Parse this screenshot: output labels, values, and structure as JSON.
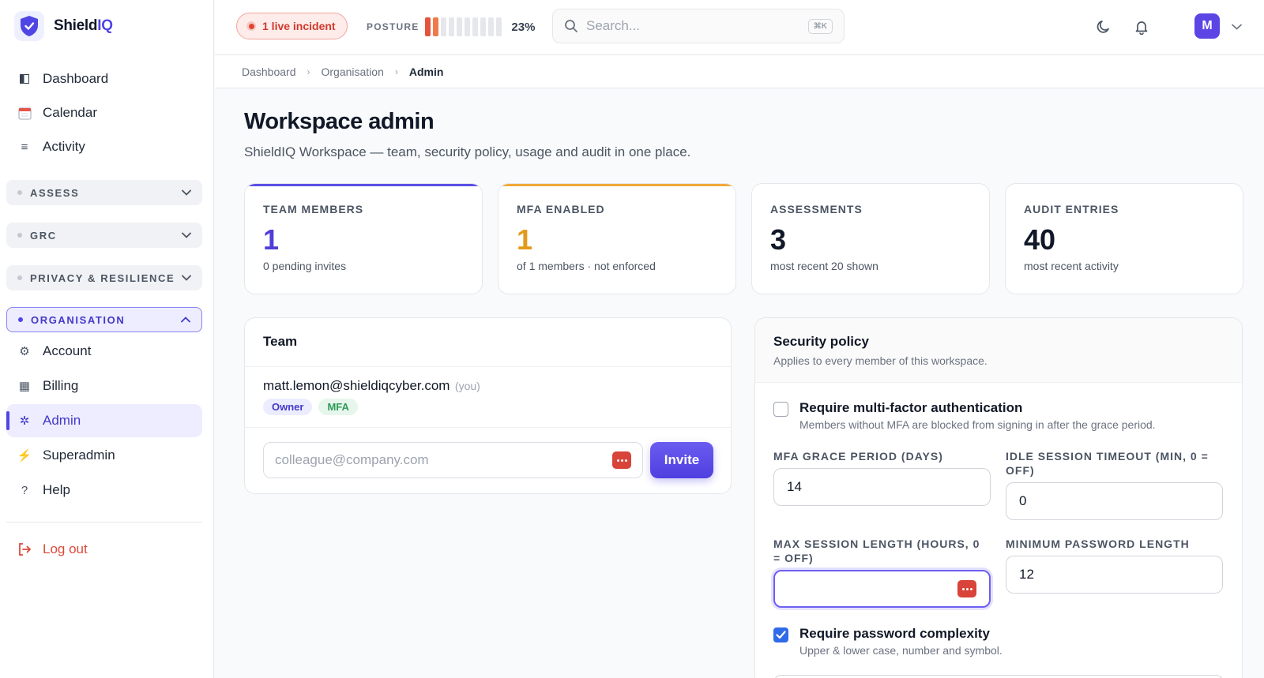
{
  "brand": {
    "name_main": "Shield",
    "name_accent": "IQ"
  },
  "sidebar": {
    "top_items": [
      {
        "label": "Dashboard",
        "icon": "sidebar-panel-icon"
      },
      {
        "label": "Calendar",
        "icon": "calendar-icon"
      },
      {
        "label": "Activity",
        "icon": "list-icon"
      }
    ],
    "groups": [
      {
        "label": "ASSESS",
        "expanded": false
      },
      {
        "label": "GRC",
        "expanded": false
      },
      {
        "label": "PRIVACY & RESILIENCE",
        "expanded": false
      },
      {
        "label": "ORGANISATION",
        "expanded": true
      }
    ],
    "org_items": [
      {
        "label": "Account",
        "icon": "gear-icon"
      },
      {
        "label": "Billing",
        "icon": "grid-icon"
      },
      {
        "label": "Admin",
        "icon": "cog-icon",
        "active": true
      },
      {
        "label": "Superadmin",
        "icon": "lightning-icon"
      },
      {
        "label": "Help",
        "icon": "question-icon"
      }
    ],
    "logout_label": "Log out"
  },
  "topbar": {
    "incident_label": "1 live incident",
    "posture_label": "POSTURE",
    "posture_value": "23%",
    "posture_fraction": 0.23,
    "search_placeholder": "Search...",
    "search_shortcut": "⌘K",
    "avatar_initial": "M"
  },
  "breadcrumb": [
    "Dashboard",
    "Organisation",
    "Admin"
  ],
  "page": {
    "title": "Workspace admin",
    "subtitle": "ShieldIQ Workspace — team, security policy, usage and audit in one place."
  },
  "stats": [
    {
      "label": "TEAM MEMBERS",
      "value": "1",
      "sub": "0 pending invites",
      "color": "#4f3fd6",
      "accent": "#5b4fe6"
    },
    {
      "label": "MFA ENABLED",
      "value": "1",
      "sub": "of 1 members · not enforced",
      "color": "#e39a1a",
      "accent": "#f0a93a"
    },
    {
      "label": "ASSESSMENTS",
      "value": "3",
      "sub": "most recent 20 shown",
      "color": "#111827",
      "accent": ""
    },
    {
      "label": "AUDIT ENTRIES",
      "value": "40",
      "sub": "most recent activity",
      "color": "#111827",
      "accent": ""
    }
  ],
  "team": {
    "title": "Team",
    "member_email": "matt.lemon@shieldiqcyber.com",
    "member_you": "(you)",
    "tag_owner": "Owner",
    "tag_mfa": "MFA",
    "invite_placeholder": "colleague@company.com",
    "invite_button": "Invite"
  },
  "policy": {
    "title": "Security policy",
    "description": "Applies to every member of this workspace.",
    "require_mfa": {
      "label": "Require multi-factor authentication",
      "desc": "Members without MFA are blocked from signing in after the grace period.",
      "checked": false
    },
    "mfa_grace": {
      "label": "MFA GRACE PERIOD (DAYS)",
      "value": "14"
    },
    "idle_timeout": {
      "label": "IDLE SESSION TIMEOUT (MIN, 0 = OFF)",
      "value": "0"
    },
    "max_session": {
      "label": "MAX SESSION LENGTH (HOURS, 0 = OFF)",
      "value": ""
    },
    "min_password": {
      "label": "MINIMUM PASSWORD LENGTH",
      "value": "12"
    },
    "complexity": {
      "label": "Require password complexity",
      "desc": "Upper & lower case, number and symbol.",
      "checked": true
    }
  }
}
